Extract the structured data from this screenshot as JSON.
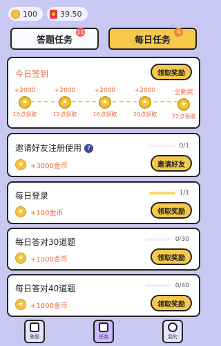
{
  "balances": {
    "coins": "100",
    "cash": "39.50"
  },
  "tabs": [
    {
      "label": "答题任务",
      "badge": "11",
      "active": false
    },
    {
      "label": "每日任务",
      "badge": "4",
      "active": true
    }
  ],
  "signin": {
    "title": "今日签到",
    "button": "领取奖励",
    "stages": [
      {
        "amount": "+2000",
        "label": "10点领取"
      },
      {
        "amount": "+2000",
        "label": "12点领取"
      },
      {
        "amount": "+2000",
        "label": "16点领取"
      },
      {
        "amount": "+2000",
        "label": "20点领取"
      },
      {
        "amount": "全勤奖",
        "label": "22点领取"
      }
    ]
  },
  "tasks": [
    {
      "title": "邀请好友注册使用",
      "reward": "+3000金币",
      "progress": "0/1",
      "fill": 0.0,
      "button": "邀请好友",
      "help": "?"
    },
    {
      "title": "每日登录",
      "reward": "+100金币",
      "progress": "1/1",
      "fill": 1.0,
      "button": "领取奖励"
    },
    {
      "title": "每日答对30道题",
      "reward": "+1000金币",
      "progress": "0/30",
      "fill": 0.0,
      "button": "领取奖励"
    },
    {
      "title": "每日答对40道题",
      "reward": "+1000金币",
      "progress": "0/40",
      "fill": 0.0,
      "button": "领取奖励"
    }
  ],
  "nav": [
    {
      "label": "答题",
      "icon": "pencil-icon",
      "active": false
    },
    {
      "label": "任务",
      "icon": "task-icon",
      "active": true
    },
    {
      "label": "我的",
      "icon": "user-icon",
      "active": false
    }
  ],
  "colors": {
    "background": "#c9c8f2",
    "accent": "#f7c94b",
    "orange": "#ec6a36"
  }
}
